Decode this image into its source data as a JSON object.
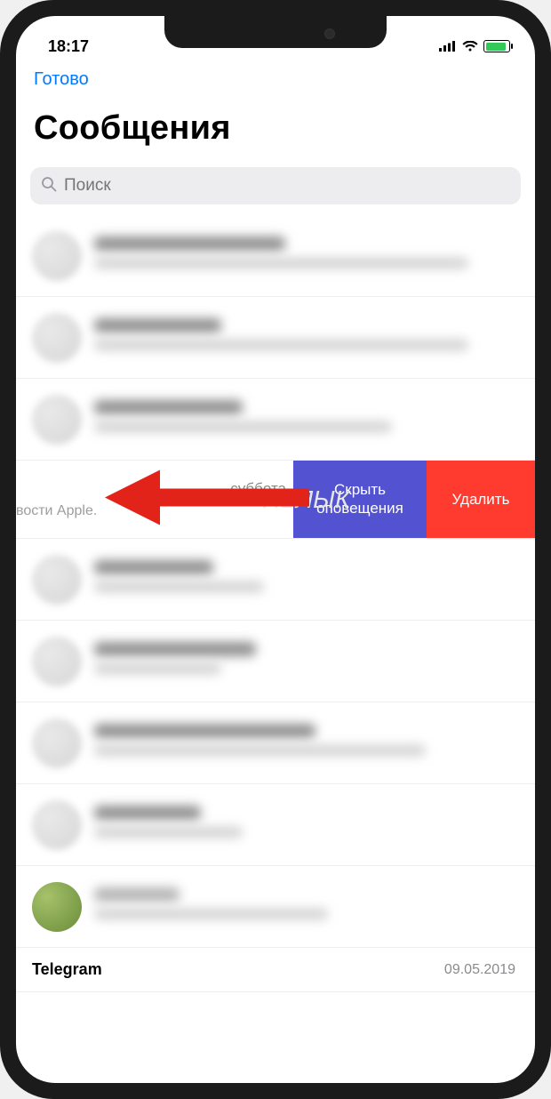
{
  "status": {
    "time": "18:17"
  },
  "header": {
    "done": "Готово",
    "title": "Сообщения"
  },
  "search": {
    "placeholder": "Поиск"
  },
  "swiped": {
    "date": "суббота",
    "preview": "вости Apple.",
    "hide_label": "Скрыть оповещения",
    "delete_label": "Удалить"
  },
  "last_row": {
    "name": "Telegram",
    "date": "09.05.2019"
  },
  "icons": {
    "search": "search-icon",
    "signal": "cellular-signal-icon",
    "wifi": "wifi-icon",
    "battery": "battery-charging-icon"
  }
}
